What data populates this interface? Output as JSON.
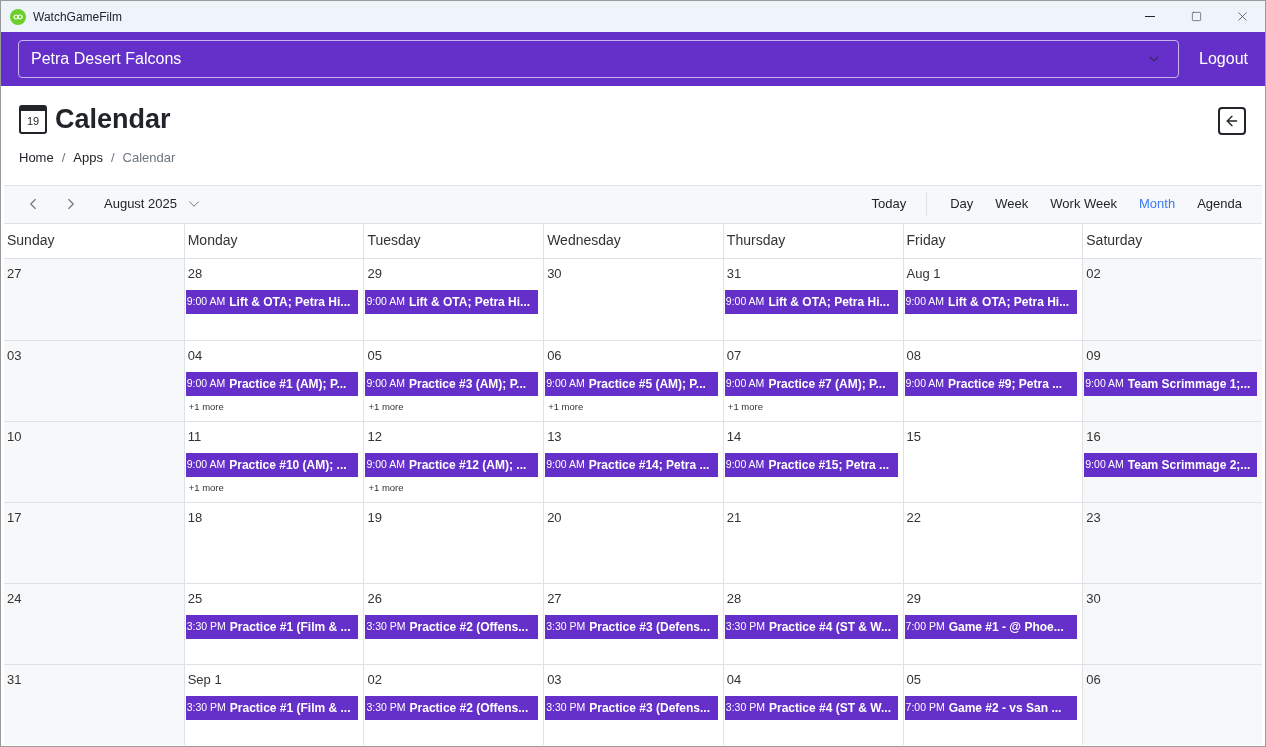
{
  "window": {
    "title": "WatchGameFilm"
  },
  "header": {
    "team": "Petra Desert Falcons",
    "logout": "Logout"
  },
  "page": {
    "title": "Calendar",
    "icon_day": "19",
    "breadcrumb_separator": "/",
    "breadcrumb": [
      {
        "label": "Home",
        "current": false
      },
      {
        "label": "Apps",
        "current": false
      },
      {
        "label": "Calendar",
        "current": true
      }
    ]
  },
  "toolbar": {
    "month": "August 2025",
    "today": "Today",
    "views": [
      {
        "label": "Day",
        "selected": false
      },
      {
        "label": "Week",
        "selected": false
      },
      {
        "label": "Work Week",
        "selected": false
      },
      {
        "label": "Month",
        "selected": true
      },
      {
        "label": "Agenda",
        "selected": false
      }
    ]
  },
  "weekdays": [
    "Sunday",
    "Monday",
    "Tuesday",
    "Wednesday",
    "Thursday",
    "Friday",
    "Saturday"
  ],
  "weeks": [
    {
      "days": [
        {
          "date": "27"
        },
        {
          "date": "28",
          "events": [
            {
              "time": "9:00 AM",
              "title": "Lift & OTA; Petra Hi..."
            }
          ]
        },
        {
          "date": "29",
          "events": [
            {
              "time": "9:00 AM",
              "title": "Lift & OTA; Petra Hi..."
            }
          ]
        },
        {
          "date": "30"
        },
        {
          "date": "31",
          "events": [
            {
              "time": "9:00 AM",
              "title": "Lift & OTA; Petra Hi..."
            }
          ]
        },
        {
          "date": "Aug 1",
          "events": [
            {
              "time": "9:00 AM",
              "title": "Lift & OTA; Petra Hi..."
            }
          ]
        },
        {
          "date": "02"
        }
      ]
    },
    {
      "days": [
        {
          "date": "03"
        },
        {
          "date": "04",
          "events": [
            {
              "time": "9:00 AM",
              "title": "Practice #1 (AM); P..."
            }
          ],
          "more": "+1 more"
        },
        {
          "date": "05",
          "events": [
            {
              "time": "9:00 AM",
              "title": "Practice #3 (AM); P..."
            }
          ],
          "more": "+1 more"
        },
        {
          "date": "06",
          "events": [
            {
              "time": "9:00 AM",
              "title": "Practice #5 (AM); P..."
            }
          ],
          "more": "+1 more"
        },
        {
          "date": "07",
          "events": [
            {
              "time": "9:00 AM",
              "title": "Practice #7 (AM); P..."
            }
          ],
          "more": "+1 more"
        },
        {
          "date": "08",
          "events": [
            {
              "time": "9:00 AM",
              "title": "Practice #9; Petra ..."
            }
          ]
        },
        {
          "date": "09",
          "events": [
            {
              "time": "9:00 AM",
              "title": "Team Scrimmage 1;..."
            }
          ]
        }
      ]
    },
    {
      "days": [
        {
          "date": "10"
        },
        {
          "date": "11",
          "events": [
            {
              "time": "9:00 AM",
              "title": "Practice #10 (AM); ..."
            }
          ],
          "more": "+1 more"
        },
        {
          "date": "12",
          "events": [
            {
              "time": "9:00 AM",
              "title": "Practice #12 (AM); ..."
            }
          ],
          "more": "+1 more"
        },
        {
          "date": "13",
          "events": [
            {
              "time": "9:00 AM",
              "title": "Practice #14; Petra ..."
            }
          ]
        },
        {
          "date": "14",
          "events": [
            {
              "time": "9:00 AM",
              "title": "Practice #15; Petra ..."
            }
          ]
        },
        {
          "date": "15"
        },
        {
          "date": "16",
          "events": [
            {
              "time": "9:00 AM",
              "title": "Team Scrimmage 2;..."
            }
          ]
        }
      ]
    },
    {
      "days": [
        {
          "date": "17"
        },
        {
          "date": "18"
        },
        {
          "date": "19"
        },
        {
          "date": "20"
        },
        {
          "date": "21"
        },
        {
          "date": "22"
        },
        {
          "date": "23"
        }
      ]
    },
    {
      "days": [
        {
          "date": "24"
        },
        {
          "date": "25",
          "events": [
            {
              "time": "3:30 PM",
              "title": "Practice #1 (Film & ..."
            }
          ]
        },
        {
          "date": "26",
          "events": [
            {
              "time": "3:30 PM",
              "title": "Practice #2 (Offens..."
            }
          ]
        },
        {
          "date": "27",
          "events": [
            {
              "time": "3:30 PM",
              "title": "Practice #3 (Defens..."
            }
          ]
        },
        {
          "date": "28",
          "events": [
            {
              "time": "3:30 PM",
              "title": "Practice #4 (ST & W..."
            }
          ]
        },
        {
          "date": "29",
          "events": [
            {
              "time": "7:00 PM",
              "title": "Game #1 - @ Phoe..."
            }
          ]
        },
        {
          "date": "30"
        }
      ]
    },
    {
      "days": [
        {
          "date": "31"
        },
        {
          "date": "Sep 1",
          "events": [
            {
              "time": "3:30 PM",
              "title": "Practice #1 (Film & ..."
            }
          ]
        },
        {
          "date": "02",
          "events": [
            {
              "time": "3:30 PM",
              "title": "Practice #2 (Offens..."
            }
          ]
        },
        {
          "date": "03",
          "events": [
            {
              "time": "3:30 PM",
              "title": "Practice #3 (Defens..."
            }
          ]
        },
        {
          "date": "04",
          "events": [
            {
              "time": "3:30 PM",
              "title": "Practice #4 (ST & W..."
            }
          ]
        },
        {
          "date": "05",
          "events": [
            {
              "time": "7:00 PM",
              "title": "Game #2 - vs San ..."
            }
          ]
        },
        {
          "date": "06"
        }
      ]
    }
  ]
}
